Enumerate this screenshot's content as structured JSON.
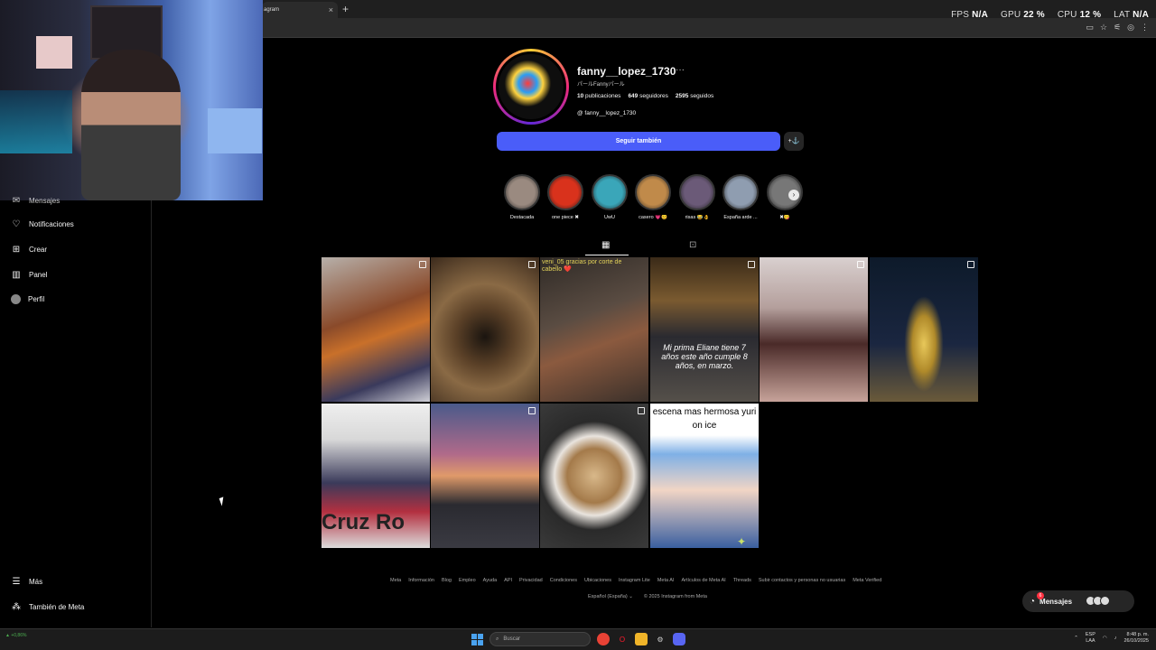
{
  "browser": {
    "tab_title": "agram",
    "new_tab": "+",
    "tab_close": "×"
  },
  "perf": {
    "fps_label": "FPS",
    "fps_value": "N/A",
    "gpu_label": "GPU",
    "gpu_value": "22 %",
    "cpu_label": "CPU",
    "cpu_value": "12 %",
    "lat_label": "LAT",
    "lat_value": "N/A"
  },
  "sidebar": {
    "partial_item": "Mensajes",
    "items": [
      {
        "label": "Notificaciones",
        "icon": "heart-icon"
      },
      {
        "label": "Crear",
        "icon": "plus-square-icon"
      },
      {
        "label": "Panel",
        "icon": "chart-icon"
      },
      {
        "label": "Perfil",
        "icon": "avatar-icon"
      }
    ],
    "more": "Más",
    "meta": "También de Meta"
  },
  "profile": {
    "username": "fanny__lopez_1730",
    "more": "···",
    "full_name": "パールFannyパール",
    "posts_count": "10",
    "posts_label": "publicaciones",
    "followers_count": "649",
    "followers_label": "seguidores",
    "following_count": "2595",
    "following_label": "seguidos",
    "threads_handle": "fanny__lopez_1730",
    "follow_button": "Seguir también",
    "suggest_button": "+⚓"
  },
  "highlights": [
    {
      "label": "Destacada",
      "color": "#9a8a80"
    },
    {
      "label": "one piece ✖",
      "color": "#d9321c"
    },
    {
      "label": "UwU",
      "color": "#3aa6b9"
    },
    {
      "label": "casero 💗😊",
      "color": "#c08a4a"
    },
    {
      "label": "risas 😂👌",
      "color": "#6b5a78"
    },
    {
      "label": "España arde ...",
      "color": "#8f9db0"
    },
    {
      "label": "✖😋",
      "color": "#777777"
    }
  ],
  "posts": [
    {
      "caption": "",
      "multi": true,
      "bg": "linear-gradient(160deg,#b7b0aa 0,#8a4a2a 40%,#c9702a 55%,#3a3a5c 80%,#cfcfd6 100%)"
    },
    {
      "caption": "",
      "multi": true,
      "bg": "radial-gradient(circle at 50% 55%,#1a140f 0,#5a4027 30%,#8a6a45 55%,#3b2a1c 100%)"
    },
    {
      "caption": "veni_05 gracias por corte de cabello ❤️",
      "multi": false,
      "bg": "linear-gradient(160deg,#2f2a26 0,#5a4c42 40%,#8b5a3f 60%,#3a302a 100%)"
    },
    {
      "caption": "Mi prima Eliane tiene 7 años este año cumple 8 años, en marzo.",
      "multi": true,
      "bg": "linear-gradient(180deg,#3a2a18 0,#7a5a30 30%,#2a2a30 55%,#55504a 100%)"
    },
    {
      "caption": "",
      "multi": true,
      "bg": "linear-gradient(180deg,#d9d0cf 0,#b49f9c 35%,#4a2a28 60%,#c7a39a 100%)"
    },
    {
      "caption": "",
      "multi": true,
      "bg": "radial-gradient(ellipse 30% 55% at 50% 60%,#e8c85a 0,#b08a2a 35%,transparent 60%),linear-gradient(180deg,#0d1a2a 0,#1a2640 60%,#6a5a3a 100%)"
    },
    {
      "caption": "Cruz Ro",
      "multi": false,
      "bg": "linear-gradient(180deg,#efefef 0,#d8d8d8 25%,#3a3a5a 55%,#b33040 75%,#dcdcdc 100%)"
    },
    {
      "caption": "",
      "multi": true,
      "bg": "linear-gradient(180deg,#4a5a8a 0,#b06a8a 35%,#e09a6a 50%,#2a2a30 70%,#3a3a42 100%)"
    },
    {
      "caption": "",
      "multi": true,
      "bg": "radial-gradient(circle at 50% 50%,#d8b88a 0,#a47a4a 30%,#e9e4de 44%,#2a2a2a 60%,#3a3a3a 100%)"
    },
    {
      "caption": "escena mas hermosa yuri on ice",
      "multi": false,
      "bg": "linear-gradient(180deg,#ffffff 0,#ffffff 22%,#7fb0e6 35%,#f1d5c5 60%,#3a5fa0 100%)"
    }
  ],
  "footer": {
    "links": [
      "Meta",
      "Información",
      "Blog",
      "Empleo",
      "Ayuda",
      "API",
      "Privacidad",
      "Condiciones",
      "Ubicaciones",
      "Instagram Lite",
      "Meta AI",
      "Artículos de Meta AI",
      "Threads",
      "Subir contactos y personas no usuarias",
      "Meta Verified"
    ],
    "language": "Español (España) ⌄",
    "copyright": "© 2025 Instagram from Meta"
  },
  "messages": {
    "label": "Mensajes",
    "badge": "6"
  },
  "taskbar": {
    "stock": "+0,86%",
    "search_placeholder": "Buscar",
    "lang_top": "ESP",
    "lang_bottom": "LAA",
    "time": "8:48 p. m.",
    "date": "26/10/2025"
  }
}
